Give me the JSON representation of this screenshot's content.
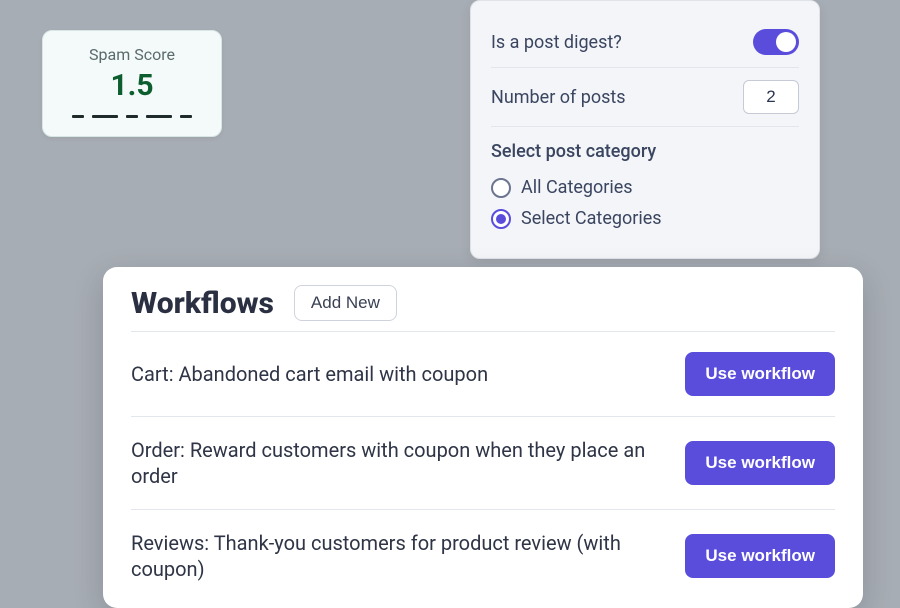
{
  "spam": {
    "label": "Spam Score",
    "value": "1.5"
  },
  "settings": {
    "digest_label": "Is a post digest?",
    "digest_on": true,
    "num_posts_label": "Number of posts",
    "num_posts_value": "2",
    "category_label": "Select post category",
    "options": {
      "all": "All Categories",
      "select": "Select Categories"
    },
    "selected": "select"
  },
  "workflows": {
    "title": "Workflows",
    "add_label": "Add New",
    "use_label": "Use workflow",
    "items": [
      {
        "title": "Cart: Abandoned cart email with coupon"
      },
      {
        "title": "Order: Reward customers with coupon when they place an order"
      },
      {
        "title": "Reviews: Thank-you customers for product review (with coupon)"
      }
    ]
  }
}
